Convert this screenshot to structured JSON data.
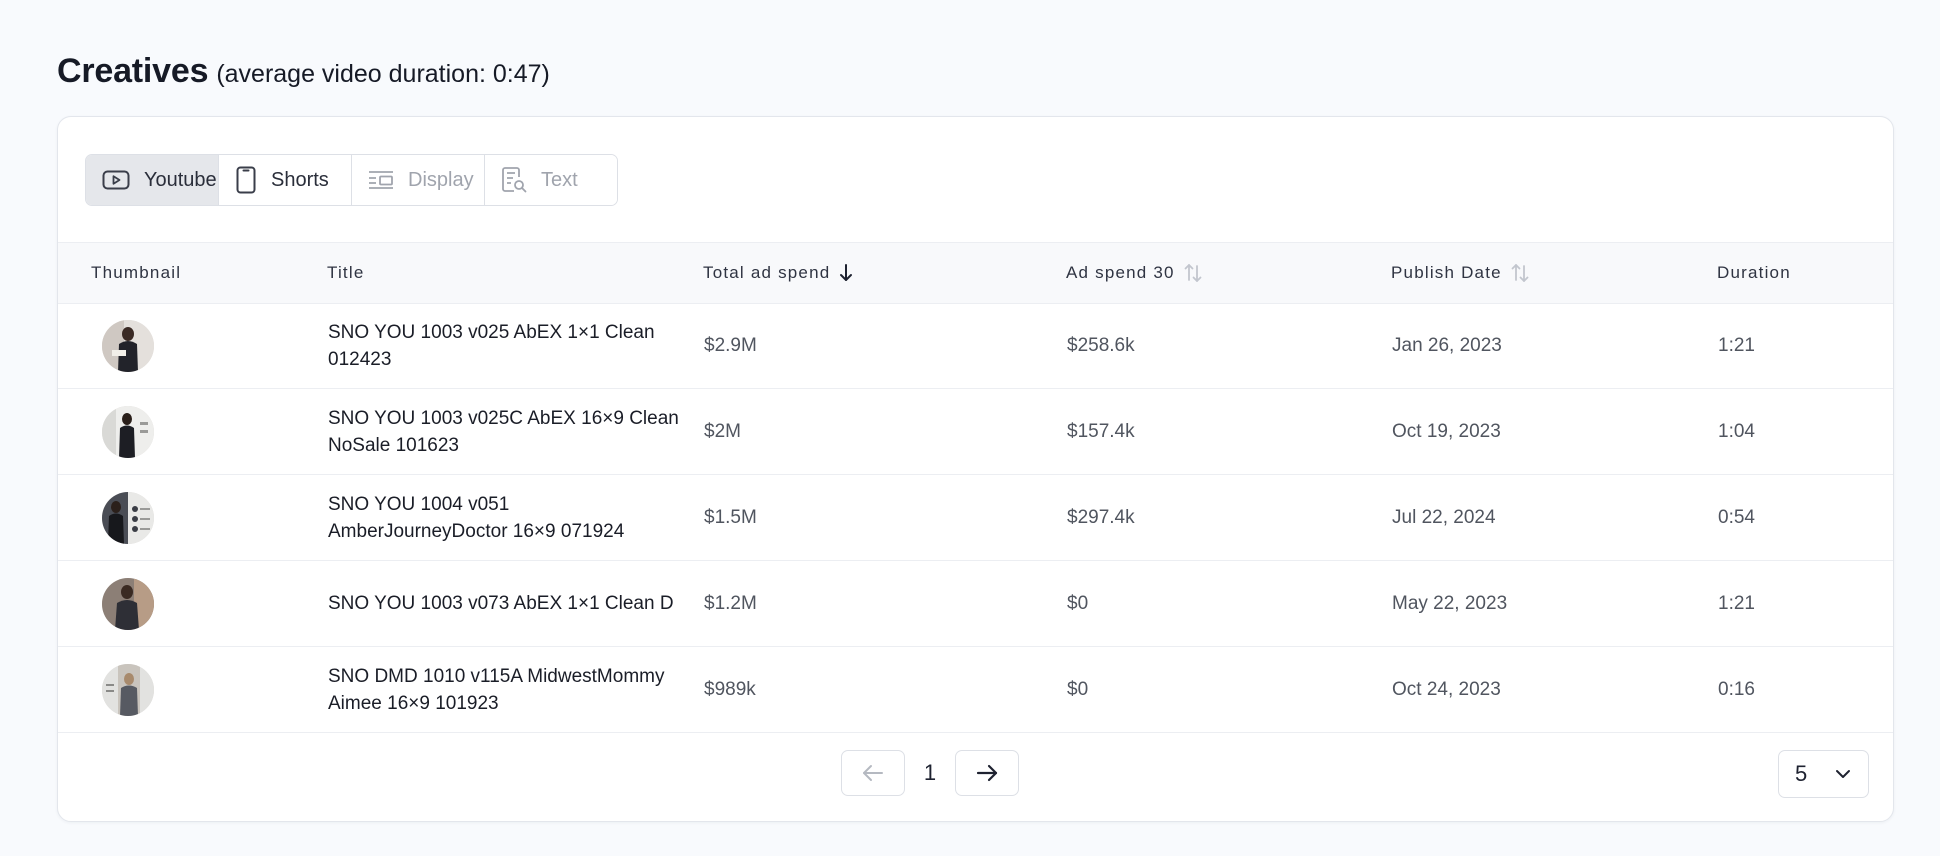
{
  "heading": {
    "title": "Creatives",
    "subtitle": "(average video duration: 0:47)"
  },
  "tabs": [
    {
      "label": "Youtube",
      "icon": "youtube-icon",
      "state": "active"
    },
    {
      "label": "Shorts",
      "icon": "shorts-phone-icon",
      "state": "enabled"
    },
    {
      "label": "Display",
      "icon": "display-layout-icon",
      "state": "disabled"
    },
    {
      "label": "Text",
      "icon": "text-search-icon",
      "state": "disabled"
    }
  ],
  "table": {
    "columns": {
      "thumbnail": "Thumbnail",
      "title": "Title",
      "total_ad_spend": "Total ad spend",
      "ad_spend_30": "Ad spend 30",
      "publish_date": "Publish Date",
      "duration": "Duration"
    },
    "sort": {
      "column": "total_ad_spend",
      "direction": "descending"
    },
    "rows": [
      {
        "title": "SNO YOU 1003 v025 AbEX 1×1 Clean 012423",
        "total_ad_spend": "$2.9M",
        "ad_spend_30": "$258.6k",
        "publish_date": "Jan 26, 2023",
        "duration": "1:21"
      },
      {
        "title": "SNO YOU 1003 v025C AbEX 16×9 Clean NoSale 101623",
        "total_ad_spend": "$2M",
        "ad_spend_30": "$157.4k",
        "publish_date": "Oct 19, 2023",
        "duration": "1:04"
      },
      {
        "title": "SNO YOU 1004 v051 AmberJourneyDoctor 16×9 071924",
        "total_ad_spend": "$1.5M",
        "ad_spend_30": "$297.4k",
        "publish_date": "Jul 22, 2024",
        "duration": "0:54"
      },
      {
        "title": "SNO YOU 1003 v073 AbEX 1×1 Clean D",
        "total_ad_spend": "$1.2M",
        "ad_spend_30": "$0",
        "publish_date": "May 22, 2023",
        "duration": "1:21"
      },
      {
        "title": "SNO DMD 1010 v115A MidwestMommy Aimee 16×9 101923",
        "total_ad_spend": "$989k",
        "ad_spend_30": "$0",
        "publish_date": "Oct 24, 2023",
        "duration": "0:16"
      }
    ]
  },
  "pagination": {
    "current_page": "1",
    "page_size": "5"
  }
}
